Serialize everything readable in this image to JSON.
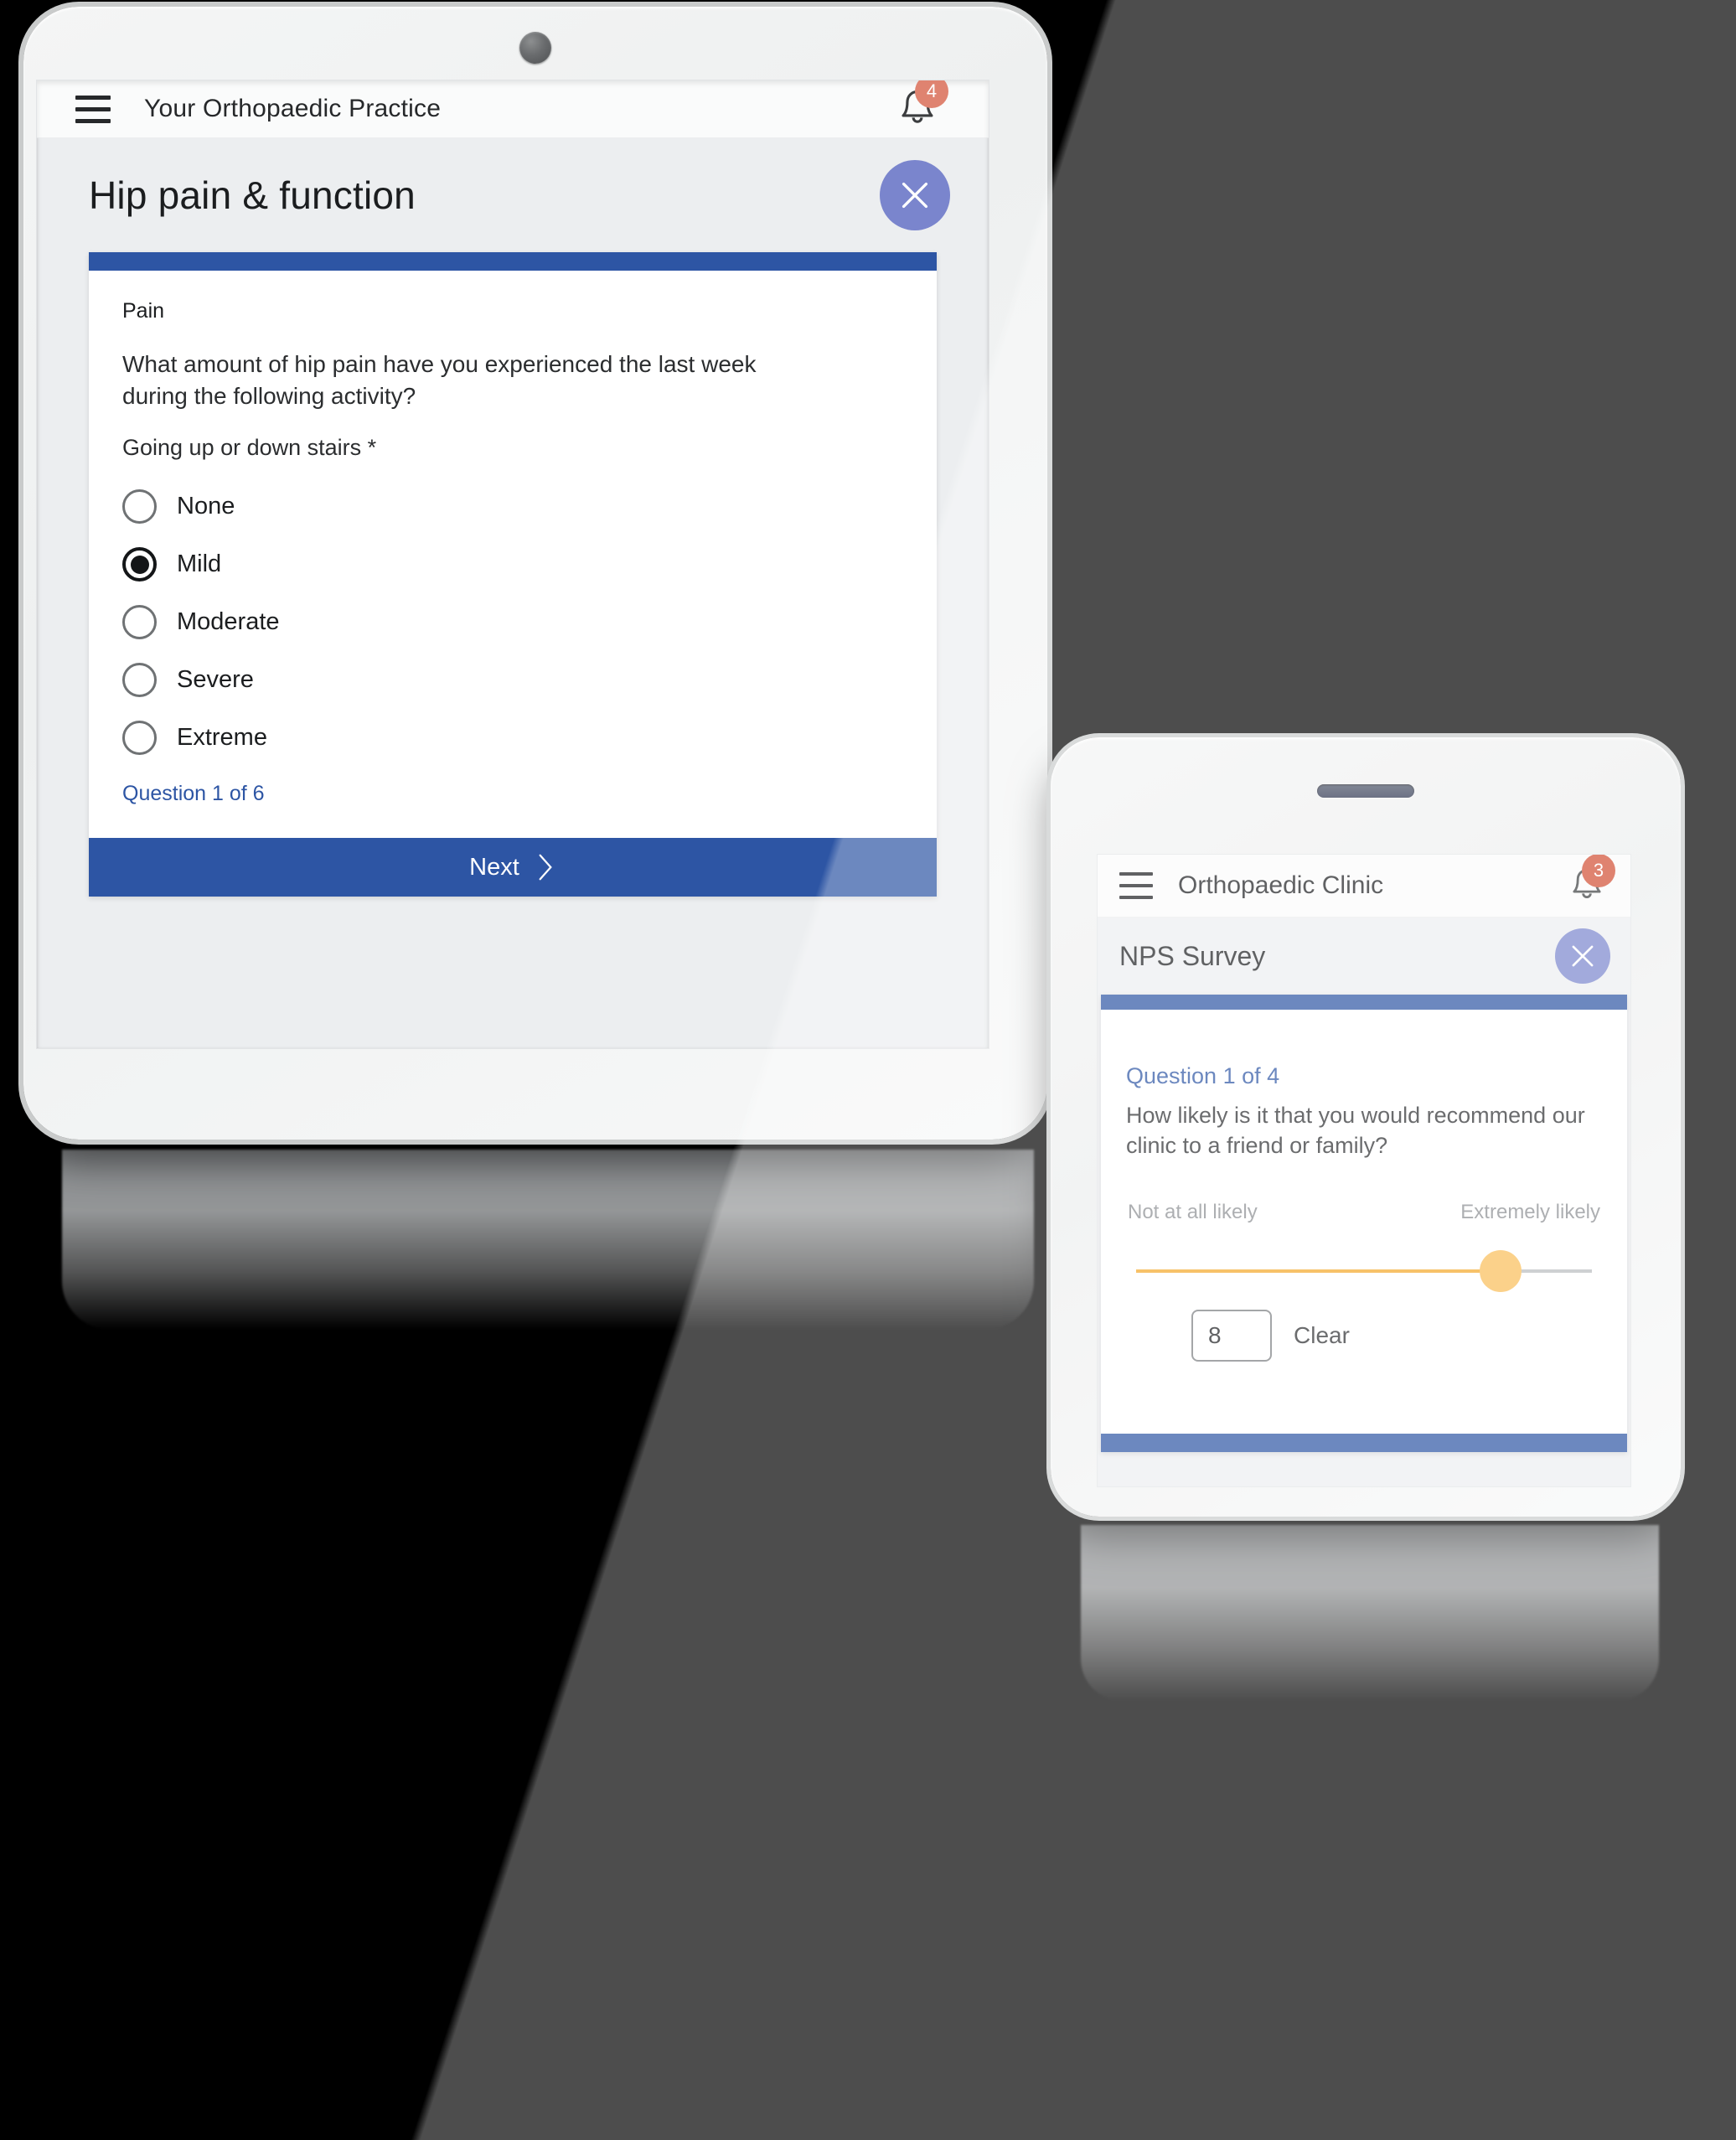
{
  "tablet": {
    "appbar": {
      "title": "Your Orthopaedic Practice",
      "menu_icon": "hamburger-icon",
      "bell_icon": "bell-icon",
      "notification_count": "4"
    },
    "page": {
      "title": "Hip pain & function",
      "close_icon": "close-icon"
    },
    "survey": {
      "section_label": "Pain",
      "question": "What amount of hip pain have you experienced the last week during the following activity?",
      "sub_question": "Going up or down stairs *",
      "options": [
        {
          "label": "None",
          "selected": false
        },
        {
          "label": "Mild",
          "selected": true
        },
        {
          "label": "Moderate",
          "selected": false
        },
        {
          "label": "Severe",
          "selected": false
        },
        {
          "label": "Extreme",
          "selected": false
        }
      ],
      "progress_text": "Question 1 of 6",
      "next_label": "Next",
      "next_icon": "chevron-right-icon"
    }
  },
  "phone": {
    "appbar": {
      "title": "Orthopaedic Clinic",
      "menu_icon": "hamburger-icon",
      "bell_icon": "bell-icon",
      "notification_count": "3"
    },
    "page": {
      "title": "NPS Survey",
      "close_icon": "close-icon"
    },
    "survey": {
      "progress_text": "Question 1 of 4",
      "question": "How likely is it that you would recommend our clinic to a friend or family?",
      "scale_low_label": "Not at all likely",
      "scale_high_label": "Extremely likely",
      "slider_value": "8",
      "slider_min": 0,
      "slider_max": 10,
      "clear_label": "Clear"
    }
  },
  "colors": {
    "primary_blue": "#2d55a4",
    "periwinkle": "#7a85cd",
    "badge_salmon": "#df8370",
    "slider_orange": "#f4a828",
    "slider_thumb": "#f9bd58"
  }
}
